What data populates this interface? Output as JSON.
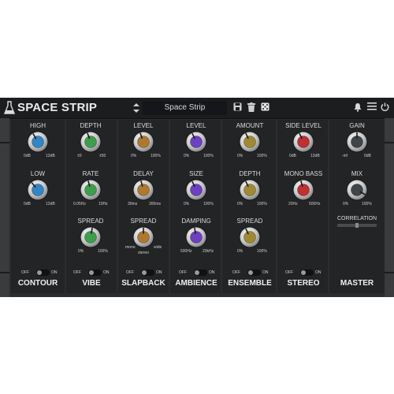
{
  "app": {
    "title": "SPACE STRIP",
    "preset": "Space Strip"
  },
  "toolbar": {
    "icons": [
      "flask-icon",
      "preset-arrows-icon",
      "save-icon",
      "trash-icon",
      "dice-icon",
      "bell-icon",
      "menu-icon",
      "power-icon"
    ]
  },
  "colors": {
    "panel": "#2b2c2e",
    "column": "#232426",
    "knob_white": "#2f86c8",
    "knob_green": "#3aa04a",
    "knob_orange": "#b0782e",
    "knob_purple": "#6e3fc2",
    "knob_olive": "#a08b2c",
    "knob_red": "#c0302d",
    "knob_gray": "#3f4548"
  },
  "sections": {
    "contour": {
      "name": "CONTOUR",
      "high": {
        "label": "HIGH",
        "min": "0dB",
        "max": "12dB"
      },
      "low": {
        "label": "LOW",
        "min": "0dB",
        "max": "12dB"
      },
      "toggle": {
        "off": "OFF",
        "on": "ON"
      }
    },
    "vibe": {
      "name": "VIBE",
      "depth": {
        "label": "DEPTH",
        "min": "±0",
        "max": "±50"
      },
      "rate": {
        "label": "RATE",
        "min": "0.05Hz",
        "max": "10Hz"
      },
      "spread": {
        "label": "SPREAD",
        "min": "0%",
        "max": "100%"
      },
      "toggle": {
        "off": "OFF",
        "on": "ON"
      }
    },
    "slapback": {
      "name": "SLAPBACK",
      "level": {
        "label": "LEVEL",
        "min": "0%",
        "max": "100%"
      },
      "delay": {
        "label": "DELAY",
        "min": "30ms",
        "max": "300ms"
      },
      "spread": {
        "label": "SPREAD",
        "min": "mono",
        "max": "wide",
        "mid": "stereo"
      },
      "toggle": {
        "off": "OFF",
        "on": "ON"
      }
    },
    "ambience": {
      "name": "AMBIENCE",
      "level": {
        "label": "LEVEL",
        "min": "0%",
        "max": "100%"
      },
      "size": {
        "label": "SIZE",
        "min": "0%",
        "max": "100%"
      },
      "damping": {
        "label": "DAMPING",
        "min": "500Hz",
        "max": "20kHz"
      },
      "toggle": {
        "off": "OFF",
        "on": "ON"
      }
    },
    "ensemble": {
      "name": "ENSEMBLE",
      "amount": {
        "label": "AMOUNT",
        "min": "0%",
        "max": "100%"
      },
      "depth": {
        "label": "DEPTH",
        "min": "0%",
        "max": "100%"
      },
      "spread": {
        "label": "SPREAD",
        "min": "0%",
        "max": "100%"
      },
      "toggle": {
        "off": "OFF",
        "on": "ON"
      }
    },
    "stereo": {
      "name": "STEREO",
      "side_level": {
        "label": "SIDE LEVEL",
        "min": "0dB",
        "max": "12dB"
      },
      "mono_bass": {
        "label": "MONO BASS",
        "min": "20Hz",
        "max": "500Hz"
      },
      "toggle": {
        "off": "OFF",
        "on": "ON"
      }
    },
    "master": {
      "name": "MASTER",
      "gain": {
        "label": "GAIN",
        "min": "-inf",
        "max": "0dB"
      },
      "mix": {
        "label": "MIX",
        "min": "0%",
        "max": "100%"
      },
      "correlation": {
        "label": "CORRELATION"
      }
    }
  }
}
